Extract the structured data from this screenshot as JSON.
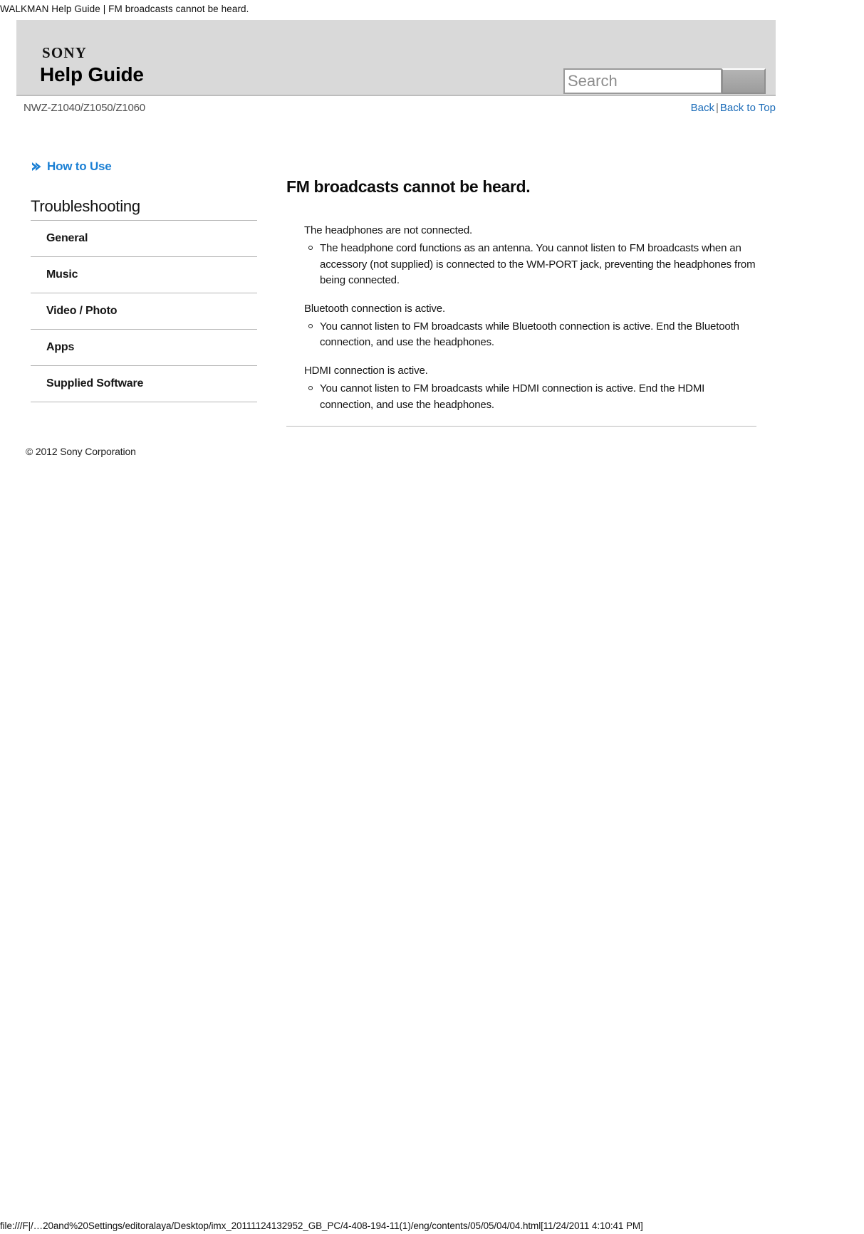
{
  "browser": {
    "print_header": "WALKMAN Help Guide | FM broadcasts cannot be heard.",
    "status_url": "file:///F|/…20and%20Settings/editoralaya/Desktop/imx_20111124132952_GB_PC/4-408-194-11(1)/eng/contents/05/05/04/04.html[11/24/2011 4:10:41 PM]"
  },
  "header": {
    "brand": "SONY",
    "title": "Help Guide",
    "search": {
      "placeholder": "Search",
      "value": "",
      "button_label": ""
    }
  },
  "subheader": {
    "model": "NWZ-Z1040/Z1050/Z1060",
    "back_label": "Back",
    "separator": "|",
    "back_to_top_label": "Back to Top"
  },
  "sidebar": {
    "how_to_use_label": "How to Use",
    "section_title": "Troubleshooting",
    "items": [
      {
        "label": "General"
      },
      {
        "label": "Music"
      },
      {
        "label": "Video / Photo"
      },
      {
        "label": "Apps"
      },
      {
        "label": "Supplied Software"
      }
    ]
  },
  "main": {
    "title": "FM broadcasts cannot be heard.",
    "blocks": [
      {
        "cause": "The headphones are not connected.",
        "remedies": [
          "The headphone cord functions as an antenna. You cannot listen to FM broadcasts when an accessory (not supplied) is connected to the WM-PORT jack, preventing the headphones from being connected."
        ]
      },
      {
        "cause": "Bluetooth connection is active.",
        "remedies": [
          "You cannot listen to FM broadcasts while Bluetooth connection is active. End the Bluetooth connection, and use the headphones."
        ]
      },
      {
        "cause": "HDMI connection is active.",
        "remedies": [
          "You cannot listen to FM broadcasts while HDMI connection is active. End the HDMI connection, and use the headphones."
        ]
      }
    ]
  },
  "footer": {
    "copyright": "© 2012 Sony Corporation"
  },
  "colors": {
    "link": "#1a6bb8",
    "accent_blue": "#1a7fd4",
    "header_band": "#d9d9d9"
  }
}
